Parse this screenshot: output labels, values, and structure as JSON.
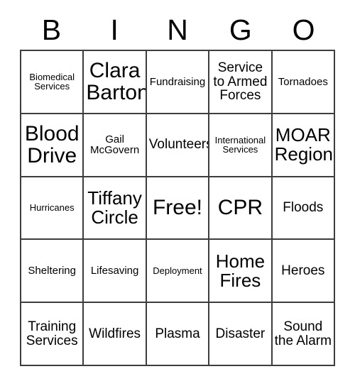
{
  "card": {
    "headers": [
      "B",
      "I",
      "N",
      "G",
      "O"
    ],
    "cells": [
      {
        "text": "Biomedical Services",
        "size": "xs"
      },
      {
        "text": "Clara Barton",
        "size": "xl"
      },
      {
        "text": "Fundraising",
        "size": "sm"
      },
      {
        "text": "Service to Armed Forces",
        "size": "md"
      },
      {
        "text": "Tornadoes",
        "size": "sm"
      },
      {
        "text": "Blood Drive",
        "size": "xl"
      },
      {
        "text": "Gail McGovern",
        "size": "sm"
      },
      {
        "text": "Volunteers",
        "size": "md"
      },
      {
        "text": "International Services",
        "size": "xs"
      },
      {
        "text": "MOAR Region",
        "size": "lg"
      },
      {
        "text": "Hurricanes",
        "size": "xs"
      },
      {
        "text": "Tiffany Circle",
        "size": "lg"
      },
      {
        "text": "Free!",
        "size": "xl"
      },
      {
        "text": "CPR",
        "size": "xl"
      },
      {
        "text": "Floods",
        "size": "md"
      },
      {
        "text": "Sheltering",
        "size": "sm"
      },
      {
        "text": "Lifesaving",
        "size": "sm"
      },
      {
        "text": "Deployment",
        "size": "xs"
      },
      {
        "text": "Home Fires",
        "size": "lg"
      },
      {
        "text": "Heroes",
        "size": "md"
      },
      {
        "text": "Training Services",
        "size": "md"
      },
      {
        "text": "Wildfires",
        "size": "md"
      },
      {
        "text": "Plasma",
        "size": "md"
      },
      {
        "text": "Disaster",
        "size": "md"
      },
      {
        "text": "Sound the Alarm",
        "size": "md"
      }
    ]
  },
  "colors": {
    "border": "#3d3d3d",
    "text": "#000000",
    "background": "#ffffff"
  }
}
